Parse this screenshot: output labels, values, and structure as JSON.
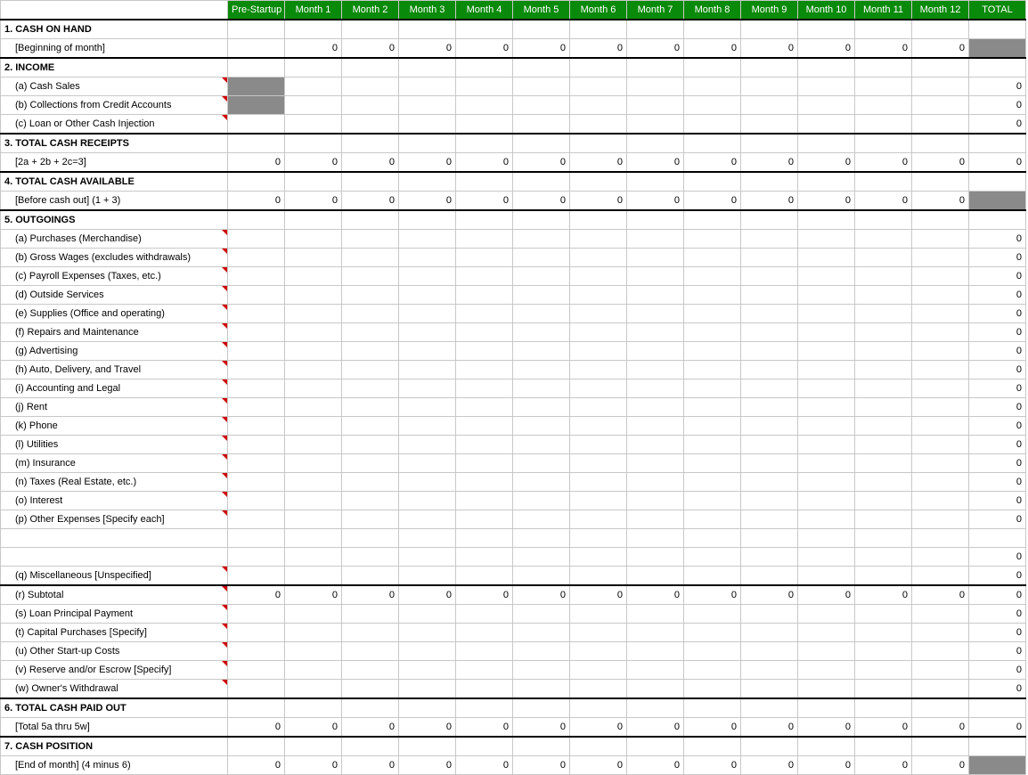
{
  "headers": {
    "blank": "",
    "pre": "Pre-Startup",
    "m1": "Month 1",
    "m2": "Month 2",
    "m3": "Month 3",
    "m4": "Month 4",
    "m5": "Month 5",
    "m6": "Month 6",
    "m7": "Month 7",
    "m8": "Month 8",
    "m9": "Month 9",
    "m10": "Month 10",
    "m11": "Month 11",
    "m12": "Month 12",
    "total": "TOTAL"
  },
  "rows": {
    "r1": {
      "label": "1. CASH ON HAND"
    },
    "r2": {
      "label": "[Beginning of month]",
      "pre": "",
      "m": [
        "0",
        "0",
        "0",
        "0",
        "0",
        "0",
        "0",
        "0",
        "0",
        "0",
        "0",
        "0"
      ],
      "total": ""
    },
    "r3": {
      "label": "2. INCOME"
    },
    "r4": {
      "label": "(a) Cash Sales",
      "total": "0"
    },
    "r5": {
      "label": "(b) Collections from Credit Accounts",
      "total": "0"
    },
    "r6": {
      "label": "(c) Loan or Other Cash Injection",
      "total": "0"
    },
    "r7": {
      "label": "3. TOTAL CASH RECEIPTS"
    },
    "r8": {
      "label": "[2a + 2b + 2c=3]",
      "pre": "0",
      "m": [
        "0",
        "0",
        "0",
        "0",
        "0",
        "0",
        "0",
        "0",
        "0",
        "0",
        "0",
        "0"
      ],
      "total": "0"
    },
    "r9": {
      "label": "4. TOTAL CASH AVAILABLE"
    },
    "r10": {
      "label": "[Before cash out] (1 + 3)",
      "pre": "0",
      "m": [
        "0",
        "0",
        "0",
        "0",
        "0",
        "0",
        "0",
        "0",
        "0",
        "0",
        "0",
        "0"
      ],
      "total": ""
    },
    "r11": {
      "label": "5. OUTGOINGS"
    },
    "r12": {
      "label": "(a) Purchases (Merchandise)",
      "total": "0"
    },
    "r13": {
      "label": "(b) Gross Wages (excludes withdrawals)",
      "total": "0"
    },
    "r14": {
      "label": "(c) Payroll Expenses (Taxes, etc.)",
      "total": "0"
    },
    "r15": {
      "label": "(d) Outside Services",
      "total": "0"
    },
    "r16": {
      "label": "(e) Supplies (Office and operating)",
      "total": "0"
    },
    "r17": {
      "label": "(f) Repairs and Maintenance",
      "total": "0"
    },
    "r18": {
      "label": "(g) Advertising",
      "total": "0"
    },
    "r19": {
      "label": "(h) Auto, Delivery, and Travel",
      "total": "0"
    },
    "r20": {
      "label": "(i) Accounting and Legal",
      "total": "0"
    },
    "r21": {
      "label": "(j) Rent",
      "total": "0"
    },
    "r22": {
      "label": "(k) Phone",
      "total": "0"
    },
    "r23": {
      "label": "(l) Utilities",
      "total": "0"
    },
    "r24": {
      "label": "(m) Insurance",
      "total": "0"
    },
    "r25": {
      "label": "(n) Taxes (Real Estate, etc.)",
      "total": "0"
    },
    "r26": {
      "label": "(o) Interest",
      "total": "0"
    },
    "r27": {
      "label": "(p) Other Expenses [Specify each]",
      "total": "0"
    },
    "r28": {
      "label": "",
      "total": ""
    },
    "r29": {
      "label": "",
      "total": "0"
    },
    "r30": {
      "label": "(q) Miscellaneous [Unspecified]",
      "total": "0"
    },
    "r31": {
      "label": "(r) Subtotal",
      "pre": "0",
      "m": [
        "0",
        "0",
        "0",
        "0",
        "0",
        "0",
        "0",
        "0",
        "0",
        "0",
        "0",
        "0"
      ],
      "total": "0"
    },
    "r32": {
      "label": "(s) Loan Principal Payment",
      "total": "0"
    },
    "r33": {
      "label": "(t) Capital Purchases [Specify]",
      "total": "0"
    },
    "r34": {
      "label": "(u) Other Start-up Costs",
      "total": "0"
    },
    "r35": {
      "label": "(v) Reserve and/or Escrow [Specify]",
      "total": "0"
    },
    "r36": {
      "label": "(w) Owner's Withdrawal",
      "total": "0"
    },
    "r37": {
      "label": "6. TOTAL CASH PAID OUT"
    },
    "r38": {
      "label": "[Total 5a thru 5w]",
      "pre": "0",
      "m": [
        "0",
        "0",
        "0",
        "0",
        "0",
        "0",
        "0",
        "0",
        "0",
        "0",
        "0",
        "0"
      ],
      "total": "0"
    },
    "r39": {
      "label": "7. CASH POSITION"
    },
    "r40": {
      "label": "[End of month]  (4 minus 6)",
      "pre": "0",
      "m": [
        "0",
        "0",
        "0",
        "0",
        "0",
        "0",
        "0",
        "0",
        "0",
        "0",
        "0",
        "0"
      ],
      "total": ""
    }
  }
}
